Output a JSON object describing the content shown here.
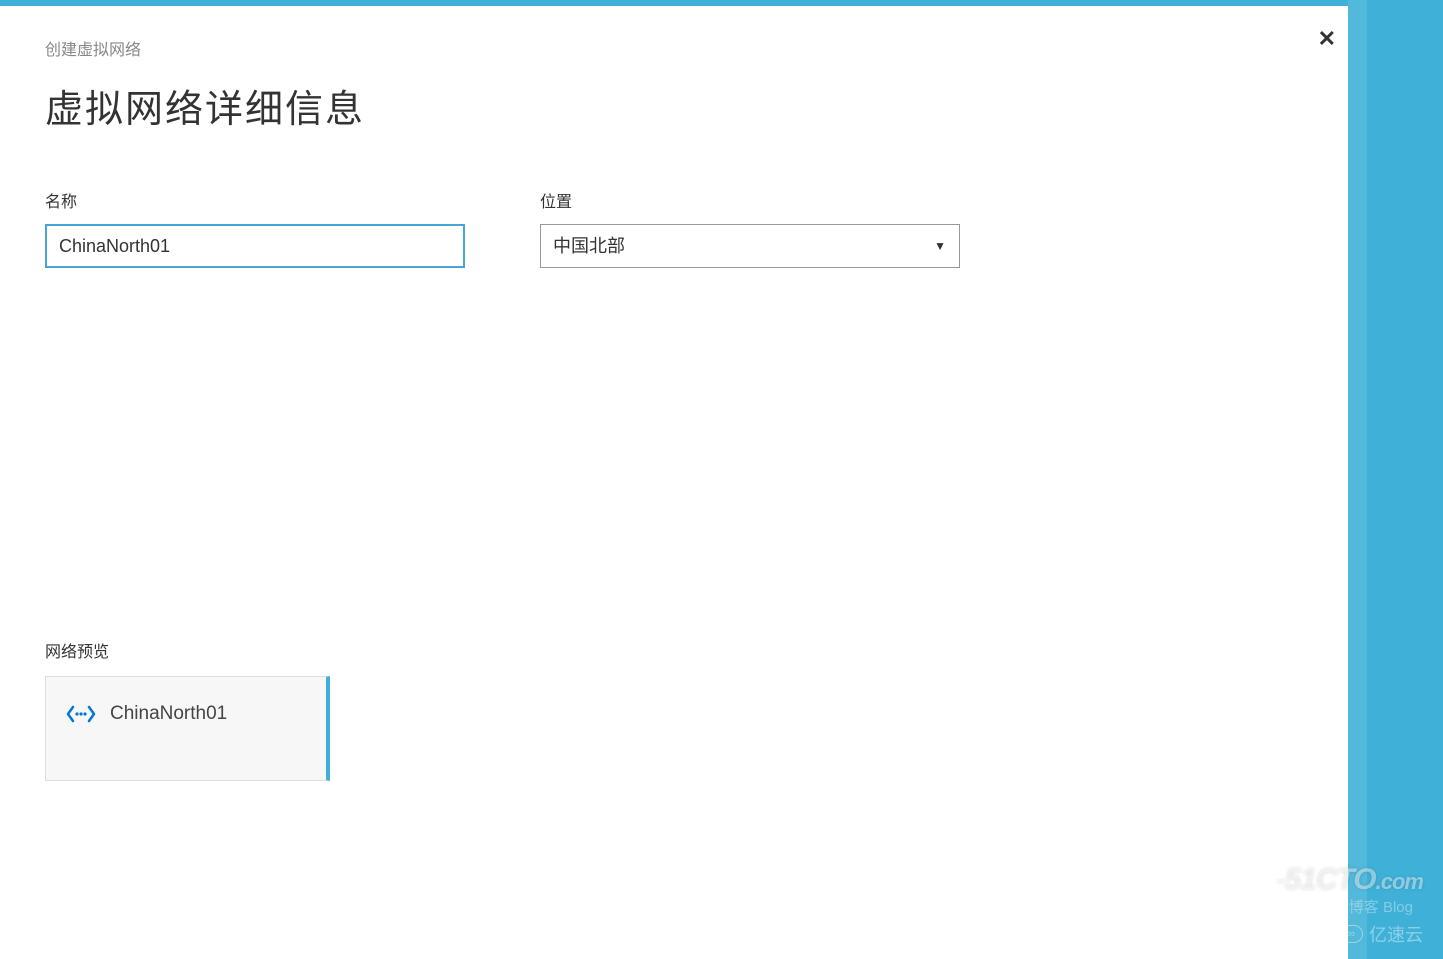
{
  "breadcrumb": "创建虚拟网络",
  "page_title": "虚拟网络详细信息",
  "close_label": "✕",
  "form": {
    "name_label": "名称",
    "name_value": "ChinaNorth01",
    "location_label": "位置",
    "location_value": "中国北部"
  },
  "preview": {
    "section_label": "网络预览",
    "card_name": "ChinaNorth01"
  },
  "watermarks": {
    "w1_prefix": "-",
    "w1_main": "51CTO",
    "w1_suffix": ".com",
    "w2": "技术博客  Blog",
    "w3": "亿速云"
  }
}
